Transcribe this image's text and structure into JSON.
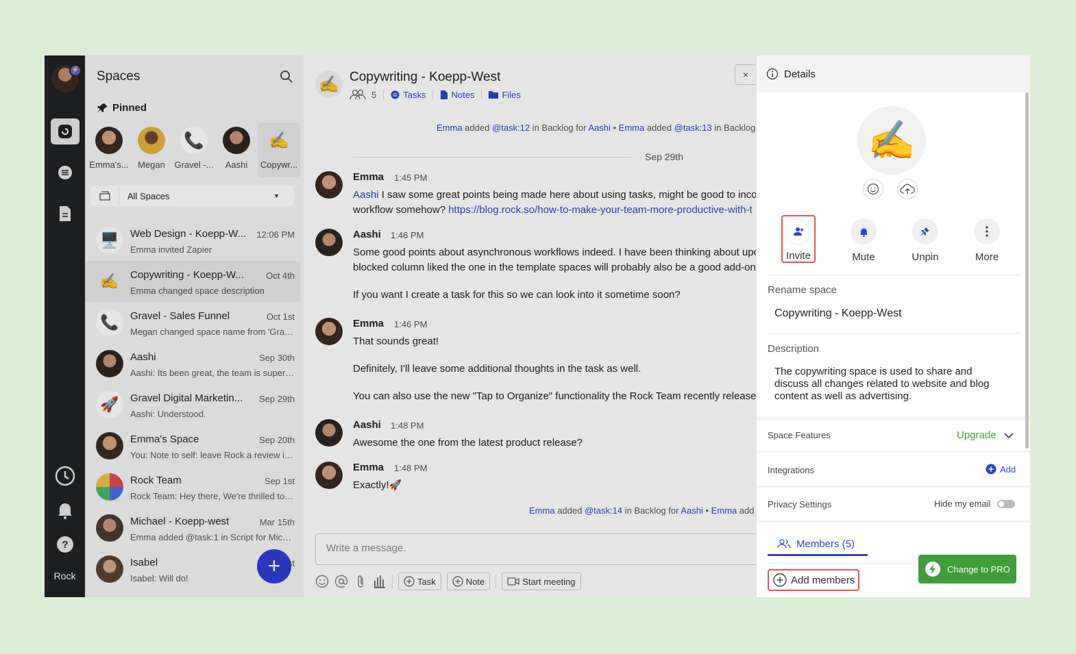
{
  "rail": {
    "label": "Rock"
  },
  "spaces": {
    "title": "Spaces",
    "pinned_heading": "Pinned",
    "pinned": [
      {
        "label": "Emma's...",
        "emoji": ""
      },
      {
        "label": "Megan",
        "emoji": ""
      },
      {
        "label": "Gravel -...",
        "emoji": "📞"
      },
      {
        "label": "Aashi",
        "emoji": ""
      },
      {
        "label": "Copywr...",
        "emoji": "✍️"
      }
    ],
    "filter": "All Spaces",
    "list": [
      {
        "name": "Web Design - Koepp-W...",
        "time": "12:06 PM",
        "preview": "Emma invited Zapier",
        "emoji": "🖥️"
      },
      {
        "name": "Copywriting - Koepp-W...",
        "time": "Oct 4th",
        "preview": "Emma changed space description",
        "emoji": "✍️"
      },
      {
        "name": "Gravel - Sales Funnel",
        "time": "Oct 1st",
        "preview": "Megan changed space name from 'Grav...",
        "emoji": "📞"
      },
      {
        "name": "Aashi",
        "time": "Sep 30th",
        "preview": "Aashi: Its been great, the team is super ...",
        "emoji": ""
      },
      {
        "name": "Gravel Digital Marketin...",
        "time": "Sep 29th",
        "preview": "Aashi: Understood.",
        "emoji": "🚀"
      },
      {
        "name": "Emma's Space",
        "time": "Sep 20th",
        "preview": "You: Note to self: leave Rock a review in ...",
        "emoji": ""
      },
      {
        "name": "Rock Team",
        "time": "Sep 1st",
        "preview": "Rock Team: Hey there, We're thrilled to a...",
        "emoji": ""
      },
      {
        "name": "Michael - Koepp-west",
        "time": "Mar 15th",
        "preview": "Emma added @task:1 in Script for Mich...",
        "emoji": ""
      },
      {
        "name": "Isabel",
        "time": "Jul 1st",
        "preview": "Isabel: Will do!",
        "emoji": ""
      }
    ],
    "fab": "+"
  },
  "chat": {
    "title": "Copywriting - Koepp-West",
    "member_count": "5",
    "tasks": "Tasks",
    "notes": "Notes",
    "files": "Files",
    "close": "×",
    "sys1": {
      "a": "Emma",
      "b": " added ",
      "c": "@task:12",
      "d": " in Backlog for ",
      "e": "Aashi",
      "f": " • ",
      "g": "Emma",
      "h": " added ",
      "i": "@task:13",
      "j": " in Backlog"
    },
    "date": "Sep 29th",
    "messages": [
      {
        "who": "Emma",
        "when": "1:45 PM",
        "mention": "Aashi",
        "line1": " I saw some great points being made here about using tasks, might be good to inco",
        "line2a": "workflow somehow? ",
        "link": "https://blog.rock.so/how-to-make-your-team-more-productive-with-t"
      },
      {
        "who": "Aashi",
        "when": "1:46 PM",
        "p1": "Some good points about asynchronous workflows indeed. I have been thinking about upc",
        "p1b": "blocked column liked the one in the template spaces will probably also be a good add-on.",
        "p2": "If you want I create a task for this so we can look into it sometime soon?"
      },
      {
        "who": "Emma",
        "when": "1:46 PM",
        "p1": "That sounds great!",
        "p2": "Definitely, I'll leave some additional thoughts in the task as well.",
        "p3": "You can also use the new \"Tap to Organize\" functionality the Rock Team recently released"
      },
      {
        "who": "Aashi",
        "when": "1:48 PM",
        "p1": "Awesome the one from the latest product release?"
      },
      {
        "who": "Emma",
        "when": "1:48 PM",
        "p1": "Exactly!🚀"
      }
    ],
    "sys2": {
      "a": "Emma",
      "b": " added ",
      "c": "@task:14",
      "d": " in Backlog for ",
      "e": "Aashi",
      "f": " • ",
      "g": "Emma",
      "h": " add"
    },
    "composer_placeholder": "Write a message.",
    "task_btn": "Task",
    "note_btn": "Note",
    "meeting_btn": "Start meeting"
  },
  "details": {
    "title": "Details",
    "avatar_emoji": "✍️",
    "actions": [
      {
        "label": "Invite",
        "icon": "add-person-icon"
      },
      {
        "label": "Mute",
        "icon": "bell-icon"
      },
      {
        "label": "Unpin",
        "icon": "pin-icon"
      },
      {
        "label": "More",
        "icon": "more-vertical-icon"
      }
    ],
    "rename_label": "Rename space",
    "rename_value": "Copywriting - Koepp-West",
    "description_label": "Description",
    "description_value": "The copywriting space is used to share and discuss all changes related to website and blog content as well as advertising.",
    "features_label": "Space Features",
    "upgrade": "Upgrade",
    "integrations_label": "Integrations",
    "add": "Add",
    "privacy_label": "Privacy Settings",
    "hide_email": "Hide my email",
    "members_tab": "Members (5)",
    "add_members": "Add members",
    "pro_button": "Change to PRO"
  },
  "colors": {
    "accent": "#2b45c7",
    "highlight": "#e0524d",
    "pro": "#3f9d3a",
    "upgrade": "#4d9b3a"
  }
}
